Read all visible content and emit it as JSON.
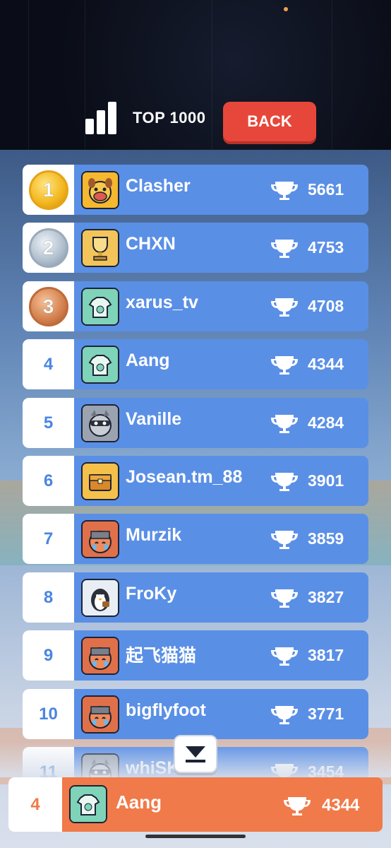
{
  "header": {
    "title": "TOP 1000",
    "back_label": "BACK"
  },
  "icons": {
    "leaderboard": "bar-chart-icon",
    "trophy": "trophy-icon",
    "scroll": "scroll-to-self-icon"
  },
  "colors": {
    "row_blue": "#5a8fe6",
    "self_orange": "#f07a49",
    "back_red": "#e7473a",
    "rank_text": "#4a86e2"
  },
  "leaderboard": {
    "rows": [
      {
        "rank": "1",
        "medal": "gold",
        "name": "Clasher",
        "score": "5661",
        "avatar": "dog-avatar"
      },
      {
        "rank": "2",
        "medal": "silver",
        "name": "CHXN",
        "score": "4753",
        "avatar": "trophy-avatar"
      },
      {
        "rank": "3",
        "medal": "bronze",
        "name": "xarus_tv",
        "score": "4708",
        "avatar": "jersey-avatar"
      },
      {
        "rank": "4",
        "name": "Aang",
        "score": "4344",
        "avatar": "jersey-avatar"
      },
      {
        "rank": "5",
        "name": "Vanille",
        "score": "4284",
        "avatar": "raccoon-avatar"
      },
      {
        "rank": "6",
        "name": "Josean.tm_88",
        "score": "3901",
        "avatar": "chest-avatar"
      },
      {
        "rank": "7",
        "name": "Murzik",
        "score": "3859",
        "avatar": "cat-avatar"
      },
      {
        "rank": "8",
        "name": "FroKy",
        "score": "3827",
        "avatar": "penguin-avatar"
      },
      {
        "rank": "9",
        "name": "起飞猫猫",
        "score": "3817",
        "avatar": "cat-avatar"
      },
      {
        "rank": "10",
        "name": "bigflyfoot",
        "score": "3771",
        "avatar": "cat-avatar"
      },
      {
        "rank": "11",
        "name": "whiSKeYU",
        "score": "3454",
        "avatar": "raccoon-avatar"
      }
    ]
  },
  "self_row": {
    "rank": "4",
    "name": "Aang",
    "score": "4344",
    "avatar": "jersey-avatar"
  }
}
